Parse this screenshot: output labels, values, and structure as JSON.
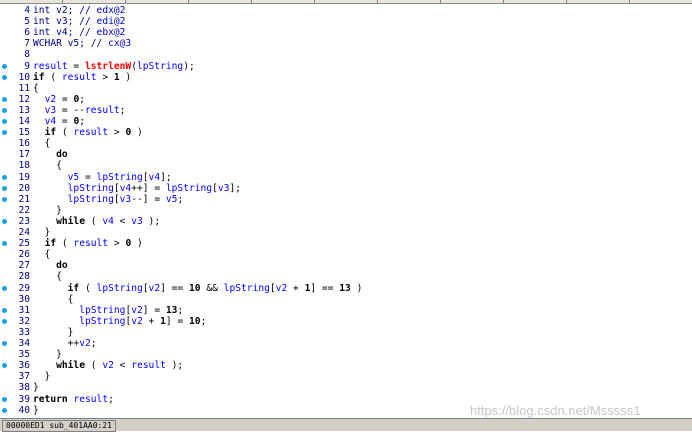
{
  "editor": {
    "lines": [
      {
        "n": "4",
        "bp": false,
        "tokens": [
          [
            "int v2; // ",
            "cm"
          ],
          [
            "edx@2",
            "reg"
          ]
        ]
      },
      {
        "n": "5",
        "bp": false,
        "tokens": [
          [
            "int v3; // ",
            "cm"
          ],
          [
            "edi@2",
            "reg"
          ]
        ]
      },
      {
        "n": "6",
        "bp": false,
        "tokens": [
          [
            "int v4; // ",
            "cm"
          ],
          [
            "ebx@2",
            "reg"
          ]
        ]
      },
      {
        "n": "7",
        "bp": false,
        "tokens": [
          [
            "WCHAR v5; // ",
            "cm"
          ],
          [
            "cx@3",
            "reg"
          ]
        ]
      },
      {
        "n": "8",
        "bp": false,
        "tokens": []
      },
      {
        "n": "9",
        "bp": true,
        "tokens": [
          [
            "result",
            "id"
          ],
          [
            " = ",
            "op"
          ],
          [
            "lstrlenW",
            "fn"
          ],
          [
            "(",
            "op"
          ],
          [
            "lpString",
            "var"
          ],
          [
            ");",
            "op"
          ]
        ]
      },
      {
        "n": "10",
        "bp": true,
        "tokens": [
          [
            "if",
            "kw"
          ],
          [
            " ( ",
            "op"
          ],
          [
            "result",
            "id"
          ],
          [
            " > ",
            "op"
          ],
          [
            "1",
            "num"
          ],
          [
            " )",
            "op"
          ]
        ]
      },
      {
        "n": "11",
        "bp": false,
        "tokens": [
          [
            "{",
            "op"
          ]
        ]
      },
      {
        "n": "12",
        "bp": true,
        "tokens": [
          [
            "  "
          ],
          [
            "v2",
            "var"
          ],
          [
            " = ",
            "op"
          ],
          [
            "0",
            "num"
          ],
          [
            ";",
            "op"
          ]
        ]
      },
      {
        "n": "13",
        "bp": true,
        "tokens": [
          [
            "  "
          ],
          [
            "v3",
            "var"
          ],
          [
            " = --",
            "op"
          ],
          [
            "result",
            "id"
          ],
          [
            ";",
            "op"
          ]
        ]
      },
      {
        "n": "14",
        "bp": true,
        "tokens": [
          [
            "  "
          ],
          [
            "v4",
            "var"
          ],
          [
            " = ",
            "op"
          ],
          [
            "0",
            "num"
          ],
          [
            ";",
            "op"
          ]
        ]
      },
      {
        "n": "15",
        "bp": true,
        "tokens": [
          [
            "  "
          ],
          [
            "if",
            "kw"
          ],
          [
            " ( ",
            "op"
          ],
          [
            "result",
            "id"
          ],
          [
            " > ",
            "op"
          ],
          [
            "0",
            "num"
          ],
          [
            " )",
            "op"
          ]
        ]
      },
      {
        "n": "16",
        "bp": false,
        "tokens": [
          [
            "  {",
            "op"
          ]
        ]
      },
      {
        "n": "17",
        "bp": false,
        "tokens": [
          [
            "    "
          ],
          [
            "do",
            "kw"
          ]
        ]
      },
      {
        "n": "18",
        "bp": false,
        "tokens": [
          [
            "    {",
            "op"
          ]
        ]
      },
      {
        "n": "19",
        "bp": true,
        "tokens": [
          [
            "      "
          ],
          [
            "v5",
            "var"
          ],
          [
            " = ",
            "op"
          ],
          [
            "lpString",
            "var"
          ],
          [
            "[",
            "op"
          ],
          [
            "v4",
            "var"
          ],
          [
            "];",
            "op"
          ]
        ]
      },
      {
        "n": "20",
        "bp": true,
        "tokens": [
          [
            "      "
          ],
          [
            "lpString",
            "var"
          ],
          [
            "[",
            "op"
          ],
          [
            "v4",
            "var"
          ],
          [
            "++] = ",
            "op"
          ],
          [
            "lpString",
            "var"
          ],
          [
            "[",
            "op"
          ],
          [
            "v3",
            "var"
          ],
          [
            "];",
            "op"
          ]
        ]
      },
      {
        "n": "21",
        "bp": true,
        "tokens": [
          [
            "      "
          ],
          [
            "lpString",
            "var"
          ],
          [
            "[",
            "op"
          ],
          [
            "v3",
            "var"
          ],
          [
            "--] = ",
            "op"
          ],
          [
            "v5",
            "var"
          ],
          [
            ";",
            "op"
          ]
        ]
      },
      {
        "n": "22",
        "bp": false,
        "tokens": [
          [
            "    }",
            "op"
          ]
        ]
      },
      {
        "n": "23",
        "bp": true,
        "tokens": [
          [
            "    "
          ],
          [
            "while",
            "kw"
          ],
          [
            " ( ",
            "op"
          ],
          [
            "v4",
            "var"
          ],
          [
            " < ",
            "op"
          ],
          [
            "v3",
            "var"
          ],
          [
            " );",
            "op"
          ]
        ]
      },
      {
        "n": "24",
        "bp": false,
        "tokens": [
          [
            "  }",
            "op"
          ]
        ]
      },
      {
        "n": "25",
        "bp": true,
        "tokens": [
          [
            "  "
          ],
          [
            "if",
            "kw"
          ],
          [
            " ( ",
            "op"
          ],
          [
            "result",
            "id"
          ],
          [
            " > ",
            "op"
          ],
          [
            "0",
            "num"
          ],
          [
            " )",
            "op"
          ]
        ]
      },
      {
        "n": "26",
        "bp": false,
        "tokens": [
          [
            "  {",
            "op"
          ]
        ]
      },
      {
        "n": "27",
        "bp": false,
        "tokens": [
          [
            "    "
          ],
          [
            "do",
            "kw"
          ]
        ]
      },
      {
        "n": "28",
        "bp": false,
        "tokens": [
          [
            "    {",
            "op"
          ]
        ]
      },
      {
        "n": "29",
        "bp": true,
        "tokens": [
          [
            "      "
          ],
          [
            "if",
            "kw"
          ],
          [
            " ( ",
            "op"
          ],
          [
            "lpString",
            "var"
          ],
          [
            "[",
            "op"
          ],
          [
            "v2",
            "var"
          ],
          [
            "] == ",
            "op"
          ],
          [
            "10",
            "num"
          ],
          [
            " && ",
            "op"
          ],
          [
            "lpString",
            "var"
          ],
          [
            "[",
            "op"
          ],
          [
            "v2",
            "var"
          ],
          [
            " + ",
            "op"
          ],
          [
            "1",
            "num"
          ],
          [
            "] == ",
            "op"
          ],
          [
            "13",
            "num"
          ],
          [
            " )",
            "op"
          ]
        ]
      },
      {
        "n": "30",
        "bp": false,
        "tokens": [
          [
            "      {",
            "op"
          ]
        ]
      },
      {
        "n": "31",
        "bp": true,
        "tokens": [
          [
            "        "
          ],
          [
            "lpString",
            "var"
          ],
          [
            "[",
            "op"
          ],
          [
            "v2",
            "var"
          ],
          [
            "] = ",
            "op"
          ],
          [
            "13",
            "num"
          ],
          [
            ";",
            "op"
          ]
        ]
      },
      {
        "n": "32",
        "bp": true,
        "tokens": [
          [
            "        "
          ],
          [
            "lpString",
            "var"
          ],
          [
            "[",
            "op"
          ],
          [
            "v2",
            "var"
          ],
          [
            " + ",
            "op"
          ],
          [
            "1",
            "num"
          ],
          [
            "] = ",
            "op"
          ],
          [
            "10",
            "num"
          ],
          [
            ";",
            "op"
          ]
        ]
      },
      {
        "n": "33",
        "bp": false,
        "tokens": [
          [
            "      }",
            "op"
          ]
        ]
      },
      {
        "n": "34",
        "bp": true,
        "tokens": [
          [
            "      ++",
            "op"
          ],
          [
            "v2",
            "var"
          ],
          [
            ";",
            "op"
          ]
        ]
      },
      {
        "n": "35",
        "bp": false,
        "tokens": [
          [
            "    }",
            "op"
          ]
        ]
      },
      {
        "n": "36",
        "bp": true,
        "tokens": [
          [
            "    "
          ],
          [
            "while",
            "kw"
          ],
          [
            " ( ",
            "op"
          ],
          [
            "v2",
            "var"
          ],
          [
            " < ",
            "op"
          ],
          [
            "result",
            "id"
          ],
          [
            " );",
            "op"
          ]
        ]
      },
      {
        "n": "37",
        "bp": false,
        "tokens": [
          [
            "  }",
            "op"
          ]
        ]
      },
      {
        "n": "38",
        "bp": false,
        "tokens": [
          [
            "}",
            "op"
          ]
        ]
      },
      {
        "n": "39",
        "bp": true,
        "tokens": [
          [
            "return",
            "kw"
          ],
          [
            " ",
            "op"
          ],
          [
            "result",
            "id"
          ],
          [
            ";",
            "op"
          ]
        ]
      },
      {
        "n": "40",
        "bp": true,
        "tokens": [
          [
            "}",
            "op"
          ]
        ]
      }
    ]
  },
  "statusbar": {
    "text": "00000ED1 sub_401AA0:21"
  },
  "watermark": {
    "text": "https://blog.csdn.net/Msssss1"
  },
  "colors": {
    "breakpoint": "#1ba1e2",
    "keyword": "#000000",
    "identifier": "#0000ff",
    "function": "#ff0000",
    "comment": "#000080"
  }
}
